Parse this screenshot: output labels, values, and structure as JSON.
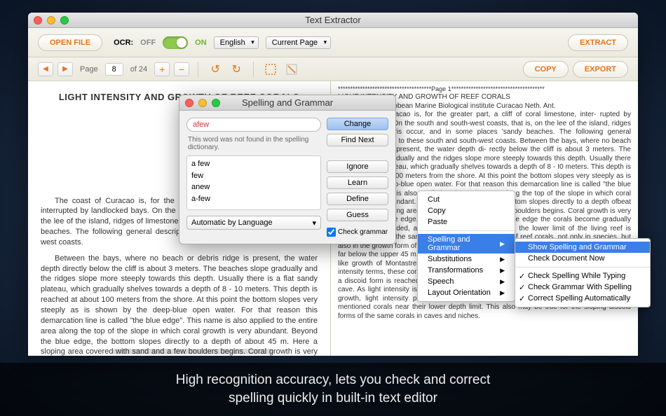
{
  "window": {
    "title": "Text Extractor"
  },
  "toolbar": {
    "open_file": "OPEN FILE",
    "ocr_label": "OCR:",
    "off": "OFF",
    "on": "ON",
    "language": "English",
    "scope": "Current Page",
    "extract": "EXTRACT"
  },
  "pager": {
    "page_label": "Page",
    "page_current": "8",
    "page_total": "of 24",
    "copy": "COPY",
    "export": "EXPORT"
  },
  "document": {
    "heading": "LIGHT INTENSITY AND GROWTH OF REEF CORALS",
    "para1": "The coast of Curacao is, for the greater part, a cliff of coral limestone, interrupted by landlocked bays. On the south and south-west coasts, that is, on the lee of the island, ridges of limestone debris occur, and in some places sandy beaches. The following general description applies to these south and south-west coasts.",
    "para2": "Between the bays, where no beach or debris ridge is present, the water depth directly below the cliff is about 3 meters. The beaches slope gradually and the ridges slope more steeply towards this depth. Usually there is a flat sandy plateau, which gradually shelves towards a depth of 8 - 10 meters. This depth is reached at about 100 meters from the shore. At this point the bottom slopes very steeply as is shown by the deep-blue open water. For that reason this demarcation line is called \"the blue edge\". This name is also applied to the entire area along the top of the slope in which coral growth is very abundant. Beyond the blue edge, the bottom slopes directly to a depth of about 45 m. Here a sloping area covered with sand and a few boulders begins. Coral growth is very rich along the blue edge. Descending the slope from the edge the corals become gradually less densely crowded, and at a depth of about 45 m, the lower limit of the living reef is reached."
  },
  "extracted": {
    "page_sep": "**************************************Page 1**************************************",
    "title": "LIGHT INTENSITY AND GROWTH OF REEF CORALS",
    "byline": "by P. J. Roos Caribbean Marine Biological institute Curacao Neth. Ant.",
    "body": "The coast of Curacao is, for the greater part, a cliff of coral limestone, inter- rupted by landlocked bays. On the south and south-west coasts, that is, on the lee of the island, ridges of limestone debris occur, and in some places 'sandy beaches. The following general description applies to these south and south-west coasts. Between the bays, where no beach or debris ridge is present, the water depth di- rectly below the cliff is about 3 meters. The beaches slope gradually and the ridges slope more steeply towards this depth. Usually there is a flat sandy plateau, which gradually shelves towards a depth of 8 - I0 meters. This depth is reached at about I00 meters from the shore. At this point the bottom slopes very steeply as is shown by the deep-blue open water. For that reason this demarcation line is called \"the blue edge\". This name is also applied to the entire area along the top of the slope in which coral growth is very abundant. Beyond the blue edge, the bottom slopes directly to a depth ofbeat 45 m. Here a sloping area covered with sand and afew boulders begins. Coral growth is very rich along the blue edge. Descending the slope from the edge the corals become gradually less densely crowded, and at a depth of about 45 m, the lower limit of the living reef is reached. Down in the sand area a certain combination of reef corals, not only in species, but also in the growth form of these corals. Several of the corals occur far below the living reef and far below the upper 45 m. Montastrea, and the leaf-like growth form of Agaricia, and the plate-like growth of Montastrea annularis increase at the expense of the massive form. In light intensity terms, these corals in the deeper parts show remarkable adaptation to reduced light. a discoid form is reached but with an elliptical outline, either single in a crevice or niche or cave. As light intensity is the limiting factor in determining the lower depth limit of reef coral growth, light intensity probably determines the characteristic growth form of the above mentioned corals near their lower depth limit. This also may be true for the sloping discoid forms of the same corals in caves and niches."
  },
  "spelling": {
    "dialog_title": "Spelling and Grammar",
    "word": "afew",
    "message": "This word was not found in the spelling dictionary.",
    "suggestions": [
      "a few",
      "few",
      "anew",
      "a-few"
    ],
    "language_mode": "Automatic by Language",
    "buttons": {
      "change": "Change",
      "find_next": "Find Next",
      "ignore": "Ignore",
      "learn": "Learn",
      "define": "Define",
      "guess": "Guess"
    },
    "check_grammar": "Check grammar"
  },
  "context_menu": {
    "cut": "Cut",
    "copy": "Copy",
    "paste": "Paste",
    "spelling": "Spelling and Grammar",
    "substitutions": "Substitutions",
    "transformations": "Transformations",
    "speech": "Speech",
    "layout": "Layout Orientation"
  },
  "submenu": {
    "show": "Show Spelling and Grammar",
    "check_now": "Check Document Now",
    "while_typing": "Check Spelling While Typing",
    "with_spelling": "Check Grammar With Spelling",
    "auto": "Correct Spelling Automatically"
  },
  "caption": {
    "line1": "High recognition accuracy, lets you check and correct",
    "line2": "spelling quickly in built-in text editor"
  }
}
